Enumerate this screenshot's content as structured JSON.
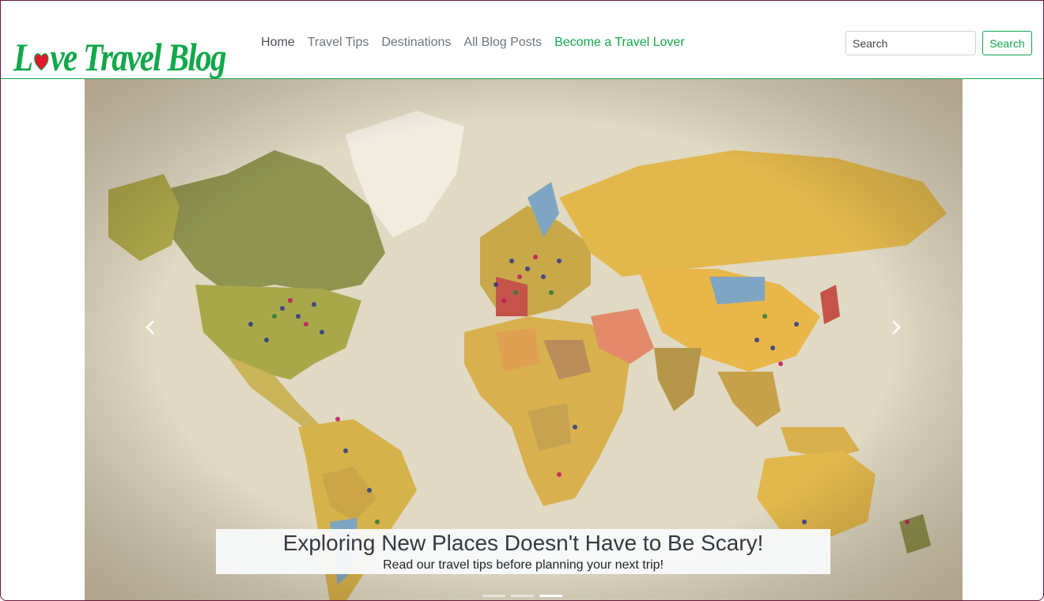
{
  "brand": {
    "name": "Love Travel Blog",
    "prefix": "L",
    "suffix": "ve Travel Blog",
    "heart_icon": "heart-icon",
    "color": "#11a84a",
    "heart_color": "#e0182d"
  },
  "nav": {
    "items": [
      {
        "label": "Home",
        "active": true
      },
      {
        "label": "Travel Tips"
      },
      {
        "label": "Destinations"
      },
      {
        "label": "All Blog Posts"
      },
      {
        "label": "Become a Travel Lover",
        "accent": true
      }
    ]
  },
  "search": {
    "placeholder": "Search",
    "button_label": "Search"
  },
  "carousel": {
    "caption_title": "Exploring New Places Doesn't Have to Be Scary!",
    "caption_text": "Read our travel tips before planning your next trip!",
    "prev_icon": "chevron-left-icon",
    "next_icon": "chevron-right-icon",
    "slide_count": 3,
    "active_slide": 3,
    "image": "world-map-with-pins"
  },
  "colors": {
    "accent": "#11a84a",
    "nav_text": "#6c757d",
    "border": "#17a34a"
  }
}
